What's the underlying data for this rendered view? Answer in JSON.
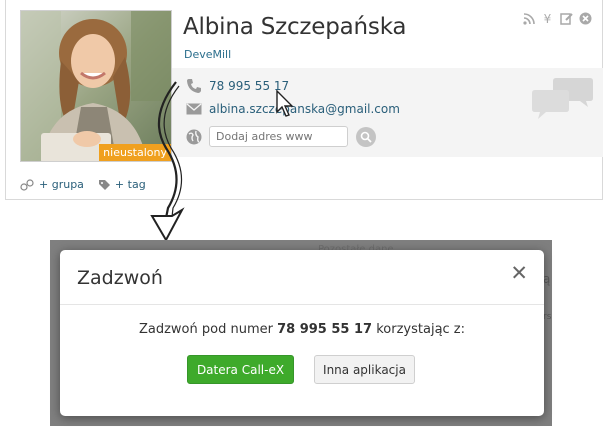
{
  "contact": {
    "name": "Albina Szczepańska",
    "company": "DeveMill",
    "status_badge": "nieustalony",
    "phone": "78 995 55 17",
    "email": "albina.szczepanska@gmail.com",
    "www_placeholder": "Dodaj adres www",
    "top_icons": [
      "rss-icon",
      "yen-icon",
      "edit-icon",
      "close-circle-icon"
    ],
    "tags": {
      "group_label": "+ grupa",
      "tag_label": "+ tag"
    }
  },
  "background": {
    "hidden_label": "Pozostałe dane",
    "edge_char_a": "ą",
    "edge_char_b": "rs"
  },
  "modal": {
    "title": "Zadzwoń",
    "close_label": "✕",
    "message_prefix": "Zadzwoń pod numer",
    "number": "78 995 55 17",
    "message_suffix": "korzystając z:",
    "primary_button": "Datera Call-eX",
    "secondary_button": "Inna aplikacja"
  },
  "colors": {
    "badge": "#f0a01e",
    "link": "#2a5f7a",
    "primary_button": "#3eaa2b",
    "backdrop": "#7f7f7f"
  }
}
